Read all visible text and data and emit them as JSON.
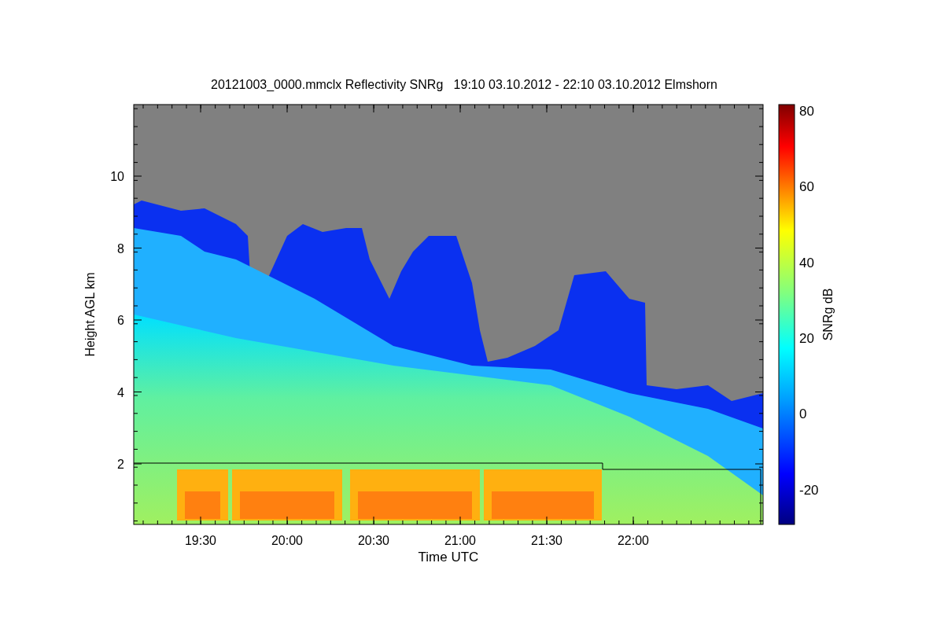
{
  "title": "20121003_0000.mmclx Reflectivity SNRg   19:10 03.10.2012 - 22:10 03.10.2012 Elmshorn",
  "plot": {
    "xlabel": "Time UTC",
    "ylabel": "Height AGL km",
    "xticks": [
      "19:30",
      "20:00",
      "20:30",
      "21:00",
      "21:30",
      "22:00"
    ],
    "yticks": [
      "10",
      "8",
      "6",
      "4",
      "2"
    ]
  },
  "colorbar": {
    "label": "SNRg dB",
    "ticks": [
      "80",
      "60",
      "40",
      "20",
      "0",
      "-20"
    ]
  }
}
